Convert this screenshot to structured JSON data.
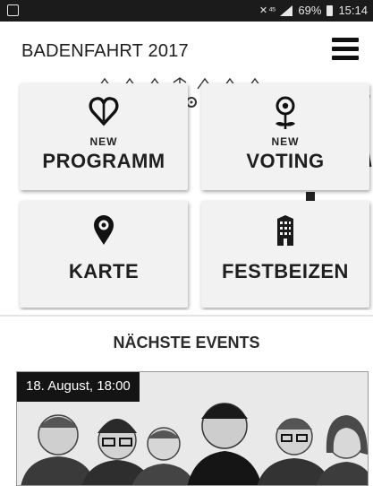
{
  "status_bar": {
    "signal_glyphs": "✕ ⁴⁵",
    "battery_percent": "69%",
    "time": "15:14"
  },
  "app_bar": {
    "title": "BADENFAHRT 2017",
    "menu_icon": "hamburger-menu-icon"
  },
  "tiles": [
    {
      "id": "programm",
      "badge": "NEW",
      "label": "PROGRAMM",
      "icon": "heart-icon"
    },
    {
      "id": "voting",
      "badge": "NEW",
      "label": "VOTING",
      "icon": "flower-icon"
    },
    {
      "id": "karte",
      "badge": "",
      "label": "KARTE",
      "icon": "map-pin-icon"
    },
    {
      "id": "festbeizen",
      "badge": "",
      "label": "FESTBEIZEN",
      "icon": "building-icon"
    }
  ],
  "events": {
    "section_title": "NÄCHSTE EVENTS",
    "items": [
      {
        "date": "18. August, 18:00"
      }
    ]
  },
  "colors": {
    "status_bar_bg": "#1b1b1b",
    "tile_bg": "#f2f2f2",
    "text": "#1f1f1f",
    "date_badge_bg": "#141414"
  }
}
